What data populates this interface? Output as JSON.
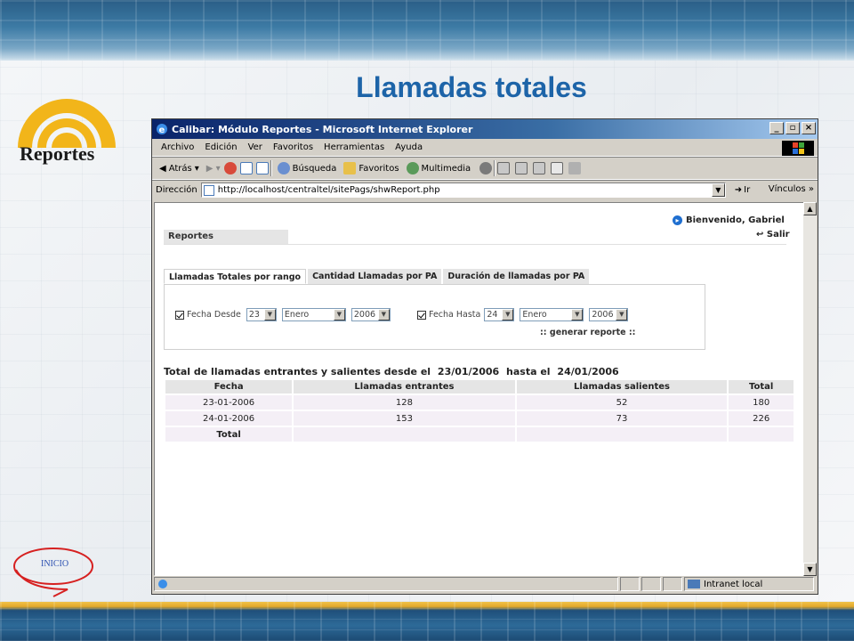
{
  "slide": {
    "title": "Llamadas totales",
    "logo_label": "Reportes",
    "home_label": "INICIO",
    "colors": {
      "title_blue": "#1d64a8",
      "logo_yellow": "#f2b51a"
    }
  },
  "browser": {
    "window_title": "Calibar: Módulo Reportes - Microsoft Internet Explorer",
    "menu": [
      "Archivo",
      "Edición",
      "Ver",
      "Favoritos",
      "Herramientas",
      "Ayuda"
    ],
    "toolbar": {
      "back": "Atrás",
      "search": "Búsqueda",
      "favorites": "Favoritos",
      "media": "Multimedia"
    },
    "address": {
      "label": "Dirección",
      "url": "http://localhost/centraltel/sitePags/shwReport.php",
      "go": "Ir",
      "links": "Vínculos"
    },
    "status": {
      "zone": "Intranet local"
    }
  },
  "page": {
    "welcome": "Bienvenido, Gabriel",
    "logout": "Salir",
    "section_tab": "Reportes",
    "tabs": [
      "Llamadas Totales por rango",
      "Cantidad Llamadas por PA",
      "Duración de llamadas por PA"
    ],
    "filter": {
      "from_label": "Fecha Desde",
      "from_day": "23",
      "from_month": "Enero",
      "from_year": "2006",
      "to_label": "Fecha Hasta",
      "to_day": "24",
      "to_month": "Enero",
      "to_year": "2006",
      "generate": ":: generar reporte ::"
    },
    "summary": {
      "prefix": "Total de llamadas entrantes y salientes desde el",
      "from": "23/01/2006",
      "middle": "hasta el",
      "to": "24/01/2006"
    },
    "table": {
      "headers": [
        "Fecha",
        "Llamadas entrantes",
        "Llamadas salientes",
        "Total"
      ],
      "rows": [
        [
          "23-01-2006",
          "128",
          "52",
          "180"
        ],
        [
          "24-01-2006",
          "153",
          "73",
          "226"
        ]
      ],
      "total_label": "Total"
    }
  }
}
